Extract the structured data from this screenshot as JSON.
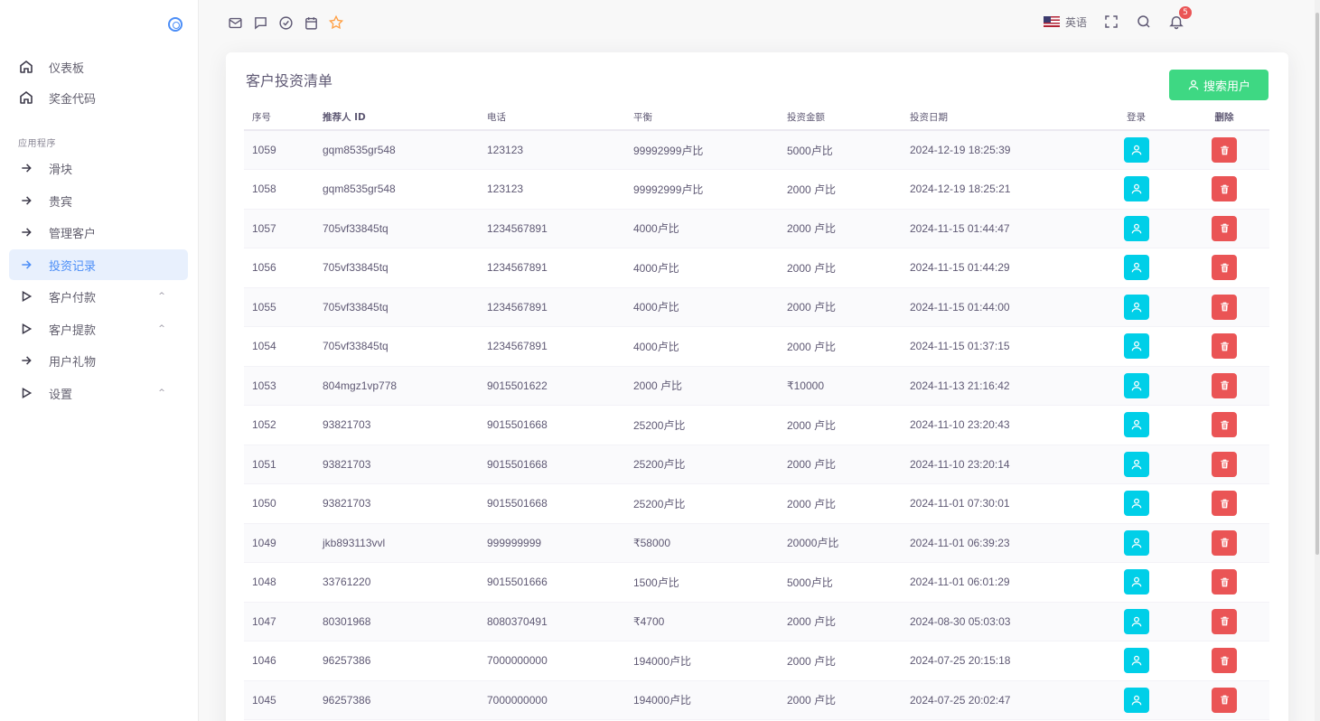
{
  "sidebar": {
    "items_top": [
      {
        "label": "仪表板",
        "icon": "home-icon"
      },
      {
        "label": "奖金代码",
        "icon": "home-icon"
      }
    ],
    "section_label": "应用程序",
    "items": [
      {
        "label": "滑块",
        "icon": "arrow-right-icon",
        "expandable": false
      },
      {
        "label": "贵宾",
        "icon": "arrow-right-icon",
        "expandable": false
      },
      {
        "label": "管理客户",
        "icon": "arrow-right-icon",
        "expandable": false
      },
      {
        "label": "投资记录",
        "icon": "arrow-right-icon",
        "expandable": false,
        "active": true
      },
      {
        "label": "客户付款",
        "icon": "play-icon",
        "expandable": true
      },
      {
        "label": "客户提款",
        "icon": "play-icon",
        "expandable": true
      },
      {
        "label": "用户礼物",
        "icon": "arrow-right-icon",
        "expandable": false
      },
      {
        "label": "设置",
        "icon": "play-icon",
        "expandable": true
      }
    ],
    "chevron": "^"
  },
  "topbar": {
    "left_icons": [
      "mail-icon",
      "chat-icon",
      "check-circle-icon",
      "calendar-icon",
      "star-icon"
    ],
    "language": "英语",
    "notification_count": "5"
  },
  "card": {
    "title": "客户投资清单",
    "search_button": "搜索用户"
  },
  "table": {
    "headers": [
      "序号",
      "推荐人 ID",
      "电话",
      "平衡",
      "投资金额",
      "投资日期",
      "登录",
      "删除"
    ],
    "rows": [
      [
        "1059",
        "gqm8535gr548",
        "123123",
        "99992999卢比",
        "5000卢比",
        "2024-12-19 18:25:39"
      ],
      [
        "1058",
        "gqm8535gr548",
        "123123",
        "99992999卢比",
        "2000 卢比",
        "2024-12-19 18:25:21"
      ],
      [
        "1057",
        "705vf33845tq",
        "1234567891",
        "4000卢比",
        "2000 卢比",
        "2024-11-15 01:44:47"
      ],
      [
        "1056",
        "705vf33845tq",
        "1234567891",
        "4000卢比",
        "2000 卢比",
        "2024-11-15 01:44:29"
      ],
      [
        "1055",
        "705vf33845tq",
        "1234567891",
        "4000卢比",
        "2000 卢比",
        "2024-11-15 01:44:00"
      ],
      [
        "1054",
        "705vf33845tq",
        "1234567891",
        "4000卢比",
        "2000 卢比",
        "2024-11-15 01:37:15"
      ],
      [
        "1053",
        "804mgz1vp778",
        "9015501622",
        "2000 卢比",
        "₹10000",
        "2024-11-13 21:16:42"
      ],
      [
        "1052",
        "93821703",
        "9015501668",
        "25200卢比",
        "2000 卢比",
        "2024-11-10 23:20:43"
      ],
      [
        "1051",
        "93821703",
        "9015501668",
        "25200卢比",
        "2000 卢比",
        "2024-11-10 23:20:14"
      ],
      [
        "1050",
        "93821703",
        "9015501668",
        "25200卢比",
        "2000 卢比",
        "2024-11-01 07:30:01"
      ],
      [
        "1049",
        "jkb893113vvl",
        "999999999",
        "₹58000",
        "20000卢比",
        "2024-11-01 06:39:23"
      ],
      [
        "1048",
        "33761220",
        "9015501666",
        "1500卢比",
        "5000卢比",
        "2024-11-01 06:01:29"
      ],
      [
        "1047",
        "80301968",
        "8080370491",
        "₹4700",
        "2000 卢比",
        "2024-08-30 05:03:03"
      ],
      [
        "1046",
        "96257386",
        "7000000000",
        "194000卢比",
        "2000 卢比",
        "2024-07-25 20:15:18"
      ],
      [
        "1045",
        "96257386",
        "7000000000",
        "194000卢比",
        "2000 卢比",
        "2024-07-25 20:02:47"
      ]
    ]
  },
  "colors": {
    "accent": "#4c8ef7",
    "login_button": "#00cfe8",
    "delete_button": "#ea5455",
    "search_button": "#3ed883"
  }
}
